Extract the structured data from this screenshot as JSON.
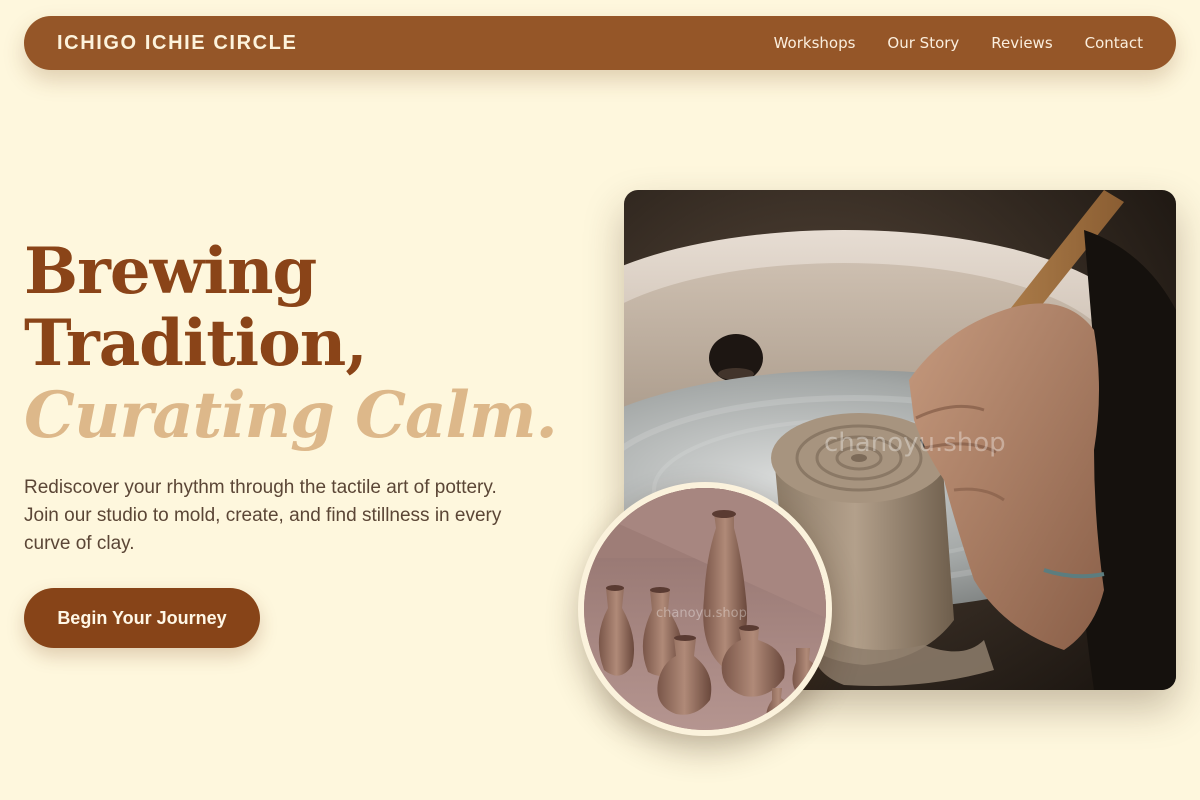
{
  "nav": {
    "brand": "ICHIGO ICHIE CIRCLE",
    "links": [
      "Workshops",
      "Our Story",
      "Reviews",
      "Contact"
    ]
  },
  "hero": {
    "title_line1": "Brewing",
    "title_line2": "Tradition,",
    "title_line3": "Curating Calm.",
    "description": "Rediscover your rhythm through the tactile art of pottery. Join our studio to mold, create, and find stillness in every curve of clay.",
    "cta_label": "Begin Your Journey"
  },
  "images": {
    "main_watermark": "chanoyu.shop",
    "inset_watermark": "chanoyu.shop"
  },
  "colors": {
    "background": "#fef7dd",
    "nav": "#955628",
    "title": "#8a4418",
    "title_accent": "#ddb88a",
    "button": "#874418"
  }
}
